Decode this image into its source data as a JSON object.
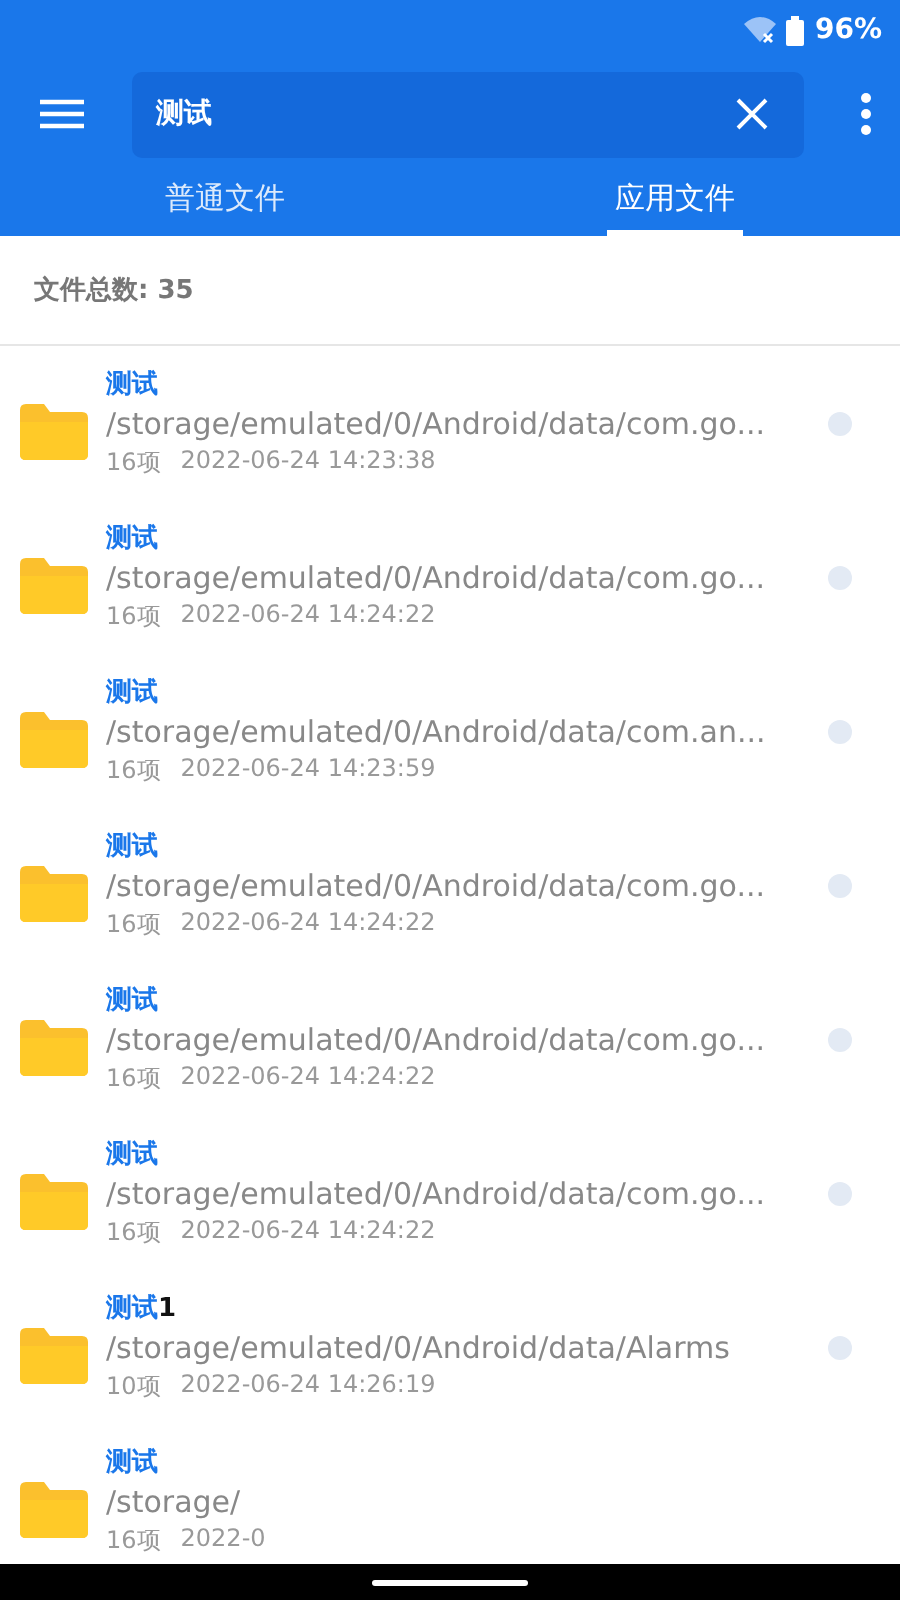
{
  "status_bar": {
    "battery": "96%"
  },
  "search": {
    "value": "测试"
  },
  "tabs": [
    {
      "label": "普通文件",
      "selected": false
    },
    {
      "label": "应用文件",
      "selected": true
    }
  ],
  "summary": "文件总数: 35",
  "files": [
    {
      "match": "测试",
      "path": "/storage/emulated/0/Android/data/com.go...",
      "count": "16项",
      "time": "2022-06-24 14:23:38",
      "selected": false
    },
    {
      "match": "测试",
      "path": "/storage/emulated/0/Android/data/com.go...",
      "count": "16项",
      "time": "2022-06-24 14:24:22",
      "selected": false
    },
    {
      "match": "测试",
      "path": "/storage/emulated/0/Android/data/com.an...",
      "count": "16项",
      "time": "2022-06-24 14:23:59",
      "selected": false
    },
    {
      "match": "测试",
      "path": "/storage/emulated/0/Android/data/com.go...",
      "count": "16项",
      "time": "2022-06-24 14:24:22",
      "selected": false
    },
    {
      "match": "测试",
      "path": "/storage/emulated/0/Android/data/com.go...",
      "count": "16项",
      "time": "2022-06-24 14:24:22",
      "selected": false
    },
    {
      "match": "测试",
      "path": "/storage/emulated/0/Android/data/com.go...",
      "count": "16项",
      "time": "2022-06-24 14:24:22",
      "selected": false
    },
    {
      "match": "测试",
      "rest": "1",
      "path": "/storage/emulated/0/Android/data/Alarms",
      "count": "10项",
      "time": "2022-06-24 14:26:19",
      "selected": false
    },
    {
      "match": "测试",
      "path": "/storage/",
      "count": "16项",
      "time": "2022-0"
    }
  ]
}
